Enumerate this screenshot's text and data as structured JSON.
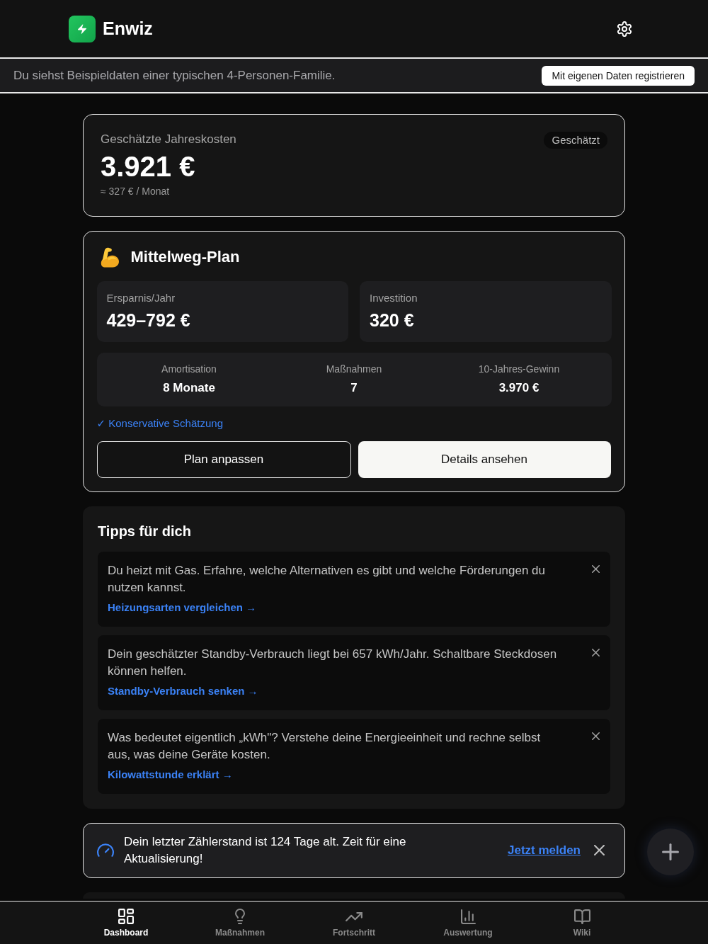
{
  "header": {
    "app_name": "Enwiz"
  },
  "demo_banner": {
    "text": "Du siehst Beispieldaten einer typischen 4-Personen-Familie.",
    "button": "Mit eigenen Daten registrieren"
  },
  "cost_card": {
    "label": "Geschätzte Jahreskosten",
    "badge": "Geschätzt",
    "amount": "3.921 €",
    "monthly": "≈ 327 € / Monat"
  },
  "plan_card": {
    "title": "Mittelweg-Plan",
    "tiles": [
      {
        "label": "Ersparnis/Jahr",
        "value": "429–792 €"
      },
      {
        "label": "Investition",
        "value": "320 €"
      }
    ],
    "stats": [
      {
        "label": "Amortisation",
        "value": "8 Monate"
      },
      {
        "label": "Maßnahmen",
        "value": "7"
      },
      {
        "label": "10-Jahres-Gewinn",
        "value": "3.970 €"
      }
    ],
    "estimate_note": "✓ Konservative Schätzung",
    "buttons": [
      {
        "label": "Plan anpassen",
        "kind": "outline"
      },
      {
        "label": "Details ansehen",
        "kind": "filled"
      }
    ]
  },
  "tips": {
    "title": "Tipps für dich",
    "items": [
      {
        "text": "Du heizt mit Gas. Erfahre, welche Alternativen es gibt und welche Förderungen du nutzen kannst.",
        "link": "Heizungsarten vergleichen →"
      },
      {
        "text": "Dein geschätzter Standby-Verbrauch liegt bei 657 kWh/Jahr. Schaltbare Steckdosen können helfen.",
        "link": "Standby-Verbrauch senken →"
      },
      {
        "text": "Was bedeutet eigentlich „kWh\"? Verstehe deine Energieeinheit und rechne selbst aus, was deine Geräte kosten.",
        "link": "Kilowattstunde erklärt →"
      }
    ]
  },
  "reminder": {
    "text": "Dein letzter Zählerstand ist 124 Tage alt. Zeit für eine Aktualisierung!",
    "link": "Jetzt melden"
  },
  "bottom_nav": [
    {
      "label": "Dashboard",
      "selected": true
    },
    {
      "label": "Maßnahmen",
      "selected": false
    },
    {
      "label": "Fortschritt",
      "selected": false
    },
    {
      "label": "Auswertung",
      "selected": false
    },
    {
      "label": "Wiki",
      "selected": false
    }
  ]
}
